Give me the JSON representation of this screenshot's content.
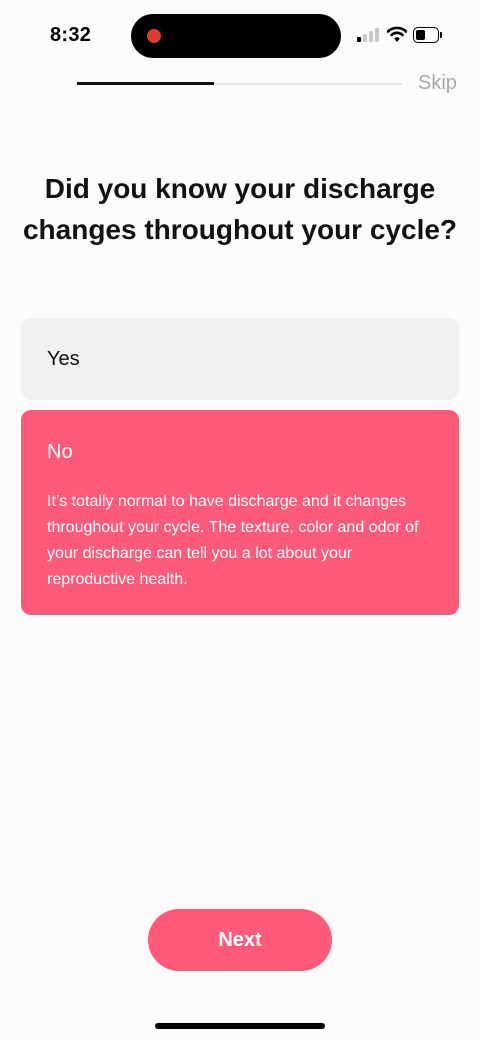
{
  "status_bar": {
    "time": "8:32",
    "signal_bars_active": 1,
    "battery_level_percent": 45,
    "icons": [
      "recording-dot-icon",
      "cellular-signal-icon",
      "wifi-icon",
      "battery-icon"
    ]
  },
  "header": {
    "progress_percent": 42,
    "skip_label": "Skip"
  },
  "question": {
    "title": "Did you know your discharge changes throughout your cycle?"
  },
  "options": [
    {
      "label": "Yes",
      "selected": false
    },
    {
      "label": "No",
      "selected": true,
      "description": "It’s totally normal to have discharge and it changes throughout your cycle. The texture, color and odor of your discharge can tell you a lot about your reproductive health."
    }
  ],
  "footer": {
    "next_label": "Next"
  },
  "colors": {
    "accent": "#fe5b7b",
    "option_background": "#f1f1f3",
    "page_background": "#fdfbfc",
    "progress_track": "#e3e3e3",
    "progress_fill": "#111111",
    "skip_text": "#a8a8a8",
    "recording_dot": "#e23b2e"
  }
}
